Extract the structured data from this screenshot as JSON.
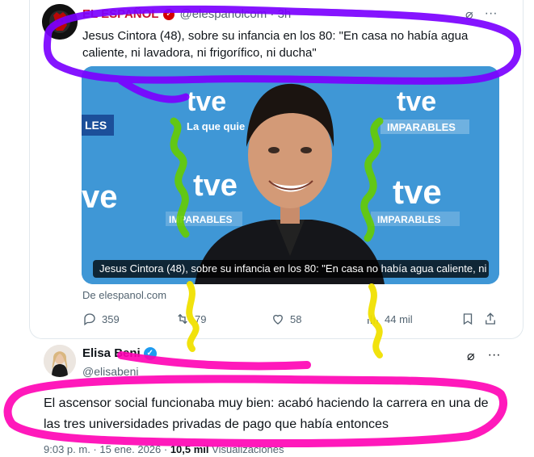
{
  "quoted_tweet": {
    "author_name": "EL ESPAÑOL",
    "handle": "@elespanolcom · 3h",
    "text": "Jesus Cintora (48), sobre su infancia en los 80: \"En casa no había agua caliente, ni lavadora, ni frigorífico, ni ducha\"",
    "media_caption": "Jesus Cintora (48), sobre su infancia en los 80: \"En casa no había agua caliente, ni ...",
    "media_logo_text": "tve",
    "media_slogan_text": "La que quie",
    "media_imparables": "IMPARABLES",
    "link_domain": "De elespanol.com",
    "actions": {
      "replies": "359",
      "retweets": "79",
      "likes": "58",
      "views": "44 mil"
    }
  },
  "main_tweet": {
    "author_name": "Elisa Beni",
    "handle": "@elisabeni",
    "text": "El ascensor social funcionaba muy bien: acabó haciendo la carrera en una de las tres universidades privadas de pago que había entonces",
    "timestamp": "9:03 p. m. · 15 ene. 2026 · ",
    "views_count": "10,5 mil",
    "views_label": " Visualizaciones"
  },
  "icons": {
    "grok": "grok-icon",
    "more": "more-icon",
    "reply": "reply-icon",
    "retweet": "retweet-icon",
    "like": "like-icon",
    "views": "views-icon",
    "bookmark": "bookmark-icon",
    "share": "share-icon"
  },
  "colors": {
    "brand_red": "#c8102e",
    "verified_blue": "#1d9bf0",
    "scribble_purple": "#7b00ff",
    "scribble_magenta": "#ff00b4",
    "scribble_yellow": "#f0e000",
    "scribble_green": "#66cc00"
  }
}
